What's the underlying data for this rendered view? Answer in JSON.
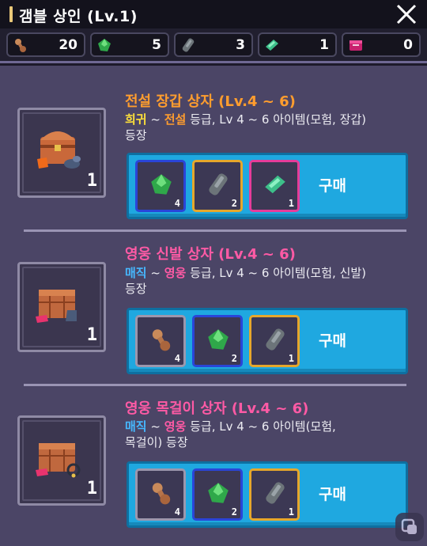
{
  "title": "갬블 상인 (Lv.1)",
  "currencies": [
    {
      "name": "bone-token",
      "value": "20"
    },
    {
      "name": "green-gem",
      "value": "5"
    },
    {
      "name": "gray-stone",
      "value": "3"
    },
    {
      "name": "teal-ticket",
      "value": "1"
    },
    {
      "name": "pink-box",
      "value": "0"
    }
  ],
  "boxes": [
    {
      "title": "전설 장갑 상자 (Lv.4 ~ 6)",
      "title_color": "#ff9d2e",
      "grade_from": "희귀",
      "grade_from_color": "#ffe13a",
      "sep1": " ~ ",
      "grade_to": "전설",
      "grade_to_color": "#ff9d2e",
      "desc_line1_rest": " 등급, Lv 4 ~ 6 아이템(모험, 장갑)",
      "desc_line2": "등장",
      "count": "1",
      "buy_label": "구매",
      "costs": [
        {
          "icon": "green-gem",
          "n": "4",
          "border": "#2a45d8"
        },
        {
          "icon": "gray-stone",
          "n": "2",
          "border": "#e6a72b"
        },
        {
          "icon": "teal-ticket",
          "n": "1",
          "border": "#e63c9a"
        }
      ]
    },
    {
      "title": "영웅 신발 상자 (Lv.4 ~ 6)",
      "title_color": "#ff5aa5",
      "grade_from": "매직",
      "grade_from_color": "#46b8ff",
      "sep1": " ~ ",
      "grade_to": "영웅",
      "grade_to_color": "#ff5aa5",
      "desc_line1_rest": " 등급, Lv 4 ~ 6 아이템(모험, 신발)",
      "desc_line2": "등장",
      "count": "1",
      "buy_label": "구매",
      "costs": [
        {
          "icon": "bone-token",
          "n": "4",
          "border": "#9c97ad"
        },
        {
          "icon": "green-gem",
          "n": "2",
          "border": "#2a45d8"
        },
        {
          "icon": "gray-stone",
          "n": "1",
          "border": "#e6a72b"
        }
      ]
    },
    {
      "title": "영웅 목걸이 상자 (Lv.4 ~ 6)",
      "title_color": "#ff5aa5",
      "grade_from": "매직",
      "grade_from_color": "#46b8ff",
      "sep1": " ~ ",
      "grade_to": "영웅",
      "grade_to_color": "#ff5aa5",
      "desc_line1_rest": " 등급, Lv 4 ~ 6 아이템(모험,",
      "desc_line2": "목걸이) 등장",
      "count": "1",
      "buy_label": "구매",
      "costs": [
        {
          "icon": "bone-token",
          "n": "4",
          "border": "#9c97ad"
        },
        {
          "icon": "green-gem",
          "n": "2",
          "border": "#2a45d8"
        },
        {
          "icon": "gray-stone",
          "n": "1",
          "border": "#e6a72b"
        }
      ]
    }
  ]
}
